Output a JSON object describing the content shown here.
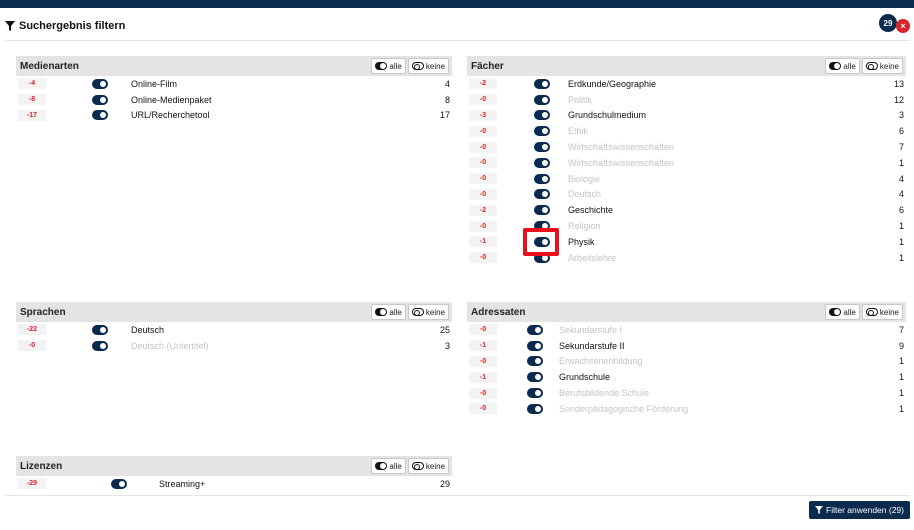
{
  "header": {
    "title": "Suchergebnis filtern",
    "count": "29",
    "close": "×"
  },
  "buttons": {
    "all": "alle",
    "none": "keine"
  },
  "panels": {
    "medienarten": {
      "title": "Medienarten",
      "rows": [
        {
          "delta": "-4",
          "label": "Online-Film",
          "count": "4",
          "dim": false
        },
        {
          "delta": "-8",
          "label": "Online-Medienpaket",
          "count": "8",
          "dim": false
        },
        {
          "delta": "-17",
          "label": "URL/Recherchetool",
          "count": "17",
          "dim": false
        }
      ]
    },
    "faecher": {
      "title": "Fächer",
      "rows": [
        {
          "delta": "-2",
          "label": "Erdkunde/Geographie",
          "count": "13",
          "dim": false
        },
        {
          "delta": "-0",
          "label": "Politik",
          "count": "12",
          "dim": true
        },
        {
          "delta": "-3",
          "label": "Grundschulmedium",
          "count": "3",
          "dim": false
        },
        {
          "delta": "-0",
          "label": "Ethik",
          "count": "6",
          "dim": true
        },
        {
          "delta": "-0",
          "label": "Wirtschaftswissenschaften",
          "count": "7",
          "dim": true
        },
        {
          "delta": "-0",
          "label": "Wirtschaftswissenschaften",
          "count": "1",
          "dim": true
        },
        {
          "delta": "-0",
          "label": "Biologie",
          "count": "4",
          "dim": true
        },
        {
          "delta": "-0",
          "label": "Deutsch",
          "count": "4",
          "dim": true
        },
        {
          "delta": "-2",
          "label": "Geschichte",
          "count": "6",
          "dim": false
        },
        {
          "delta": "-0",
          "label": "Religion",
          "count": "1",
          "dim": true
        },
        {
          "delta": "-1",
          "label": "Physik",
          "count": "1",
          "dim": false
        },
        {
          "delta": "-0",
          "label": "Arbeitslehre",
          "count": "1",
          "dim": true
        }
      ]
    },
    "sprachen": {
      "title": "Sprachen",
      "rows": [
        {
          "delta": "-22",
          "label": "Deutsch",
          "count": "25",
          "dim": false
        },
        {
          "delta": "-0",
          "label": "Deutsch (Untertitel)",
          "count": "3",
          "dim": true
        }
      ]
    },
    "adressaten": {
      "title": "Adressaten",
      "rows": [
        {
          "delta": "-0",
          "label": "Sekundarstufe I",
          "count": "7",
          "dim": true
        },
        {
          "delta": "-1",
          "label": "Sekundarstufe II",
          "count": "9",
          "dim": false
        },
        {
          "delta": "-0",
          "label": "Erwachsenenbildung",
          "count": "1",
          "dim": true
        },
        {
          "delta": "-1",
          "label": "Grundschule",
          "count": "1",
          "dim": false
        },
        {
          "delta": "-0",
          "label": "Berufsbildende Schule",
          "count": "1",
          "dim": true
        },
        {
          "delta": "-0",
          "label": "Sonderpädagogische Förderung",
          "count": "1",
          "dim": true
        }
      ]
    },
    "lizenzen": {
      "title": "Lizenzen",
      "rows": [
        {
          "delta": "-29",
          "label": "Streaming+",
          "count": "29",
          "dim": false
        }
      ]
    }
  },
  "footer": {
    "apply_label": "Filter anwenden (29)"
  },
  "colors": {
    "navy": "#0a2a4e",
    "red": "#d9232a",
    "highlight": "#e8101a"
  }
}
